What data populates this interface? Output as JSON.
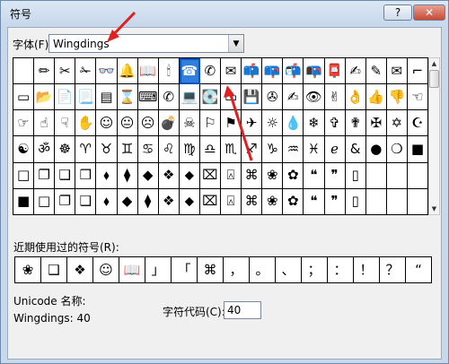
{
  "window": {
    "title": "符号",
    "help": "?",
    "close": "✕"
  },
  "font": {
    "label": "字体(F):",
    "value": "Wingdings"
  },
  "grid": [
    [
      "",
      "✏",
      "✂",
      "✁",
      "👓",
      "🔔",
      "📖",
      "🕯",
      "☎",
      "✆",
      "✉",
      "📫",
      "📪",
      "📬",
      "📭",
      "📮",
      "✍",
      "✎",
      "✉",
      "⌐"
    ],
    [
      "▭",
      "📂",
      "📄",
      "📃",
      "▤",
      "⌛",
      "⌨",
      "✆",
      "💻",
      "💽",
      "▭",
      "💾",
      "✇",
      "✍",
      "👁",
      "✌",
      "👌",
      "👍",
      "👎",
      "☜"
    ],
    [
      "☞",
      "☝",
      "☟",
      "✋",
      "☺",
      "😐",
      "☹",
      "💣",
      "☠",
      "⚐",
      "⚑",
      "✈",
      "☼",
      "💧",
      "❄",
      "✞",
      "✟",
      "✠",
      "✡",
      "☪"
    ],
    [
      "☯",
      "ॐ",
      "☸",
      "♈",
      "♉",
      "♊",
      "♋",
      "♌",
      "♍",
      "♎",
      "♏",
      "♐",
      "♑",
      "♒",
      "♓",
      "ℯ",
      "&",
      "●",
      "❍",
      "■"
    ],
    [
      "□",
      "❐",
      "❑",
      "❒",
      "⬧",
      "⧫",
      "◆",
      "❖",
      "⬥",
      "⌧",
      "⍓",
      "⌘",
      "❀",
      "✿",
      "❝",
      "❞",
      "▯",
      "",
      "",
      ""
    ],
    [
      "■",
      "□",
      "❐",
      "❑",
      "⬧",
      "◆",
      "⧫",
      "❖",
      "⬥",
      "⌧",
      "⍓",
      "⌘",
      "❀",
      "✿",
      "❝",
      "❞",
      "▯",
      "",
      "",
      ""
    ]
  ],
  "recent": {
    "label": "近期使用过的符号(R):",
    "items": [
      "❀",
      "❑",
      "❖",
      "☺",
      "📖",
      "」",
      "「",
      "⌘",
      "，",
      "。",
      "、",
      "；",
      "：",
      "！",
      "？",
      "“"
    ]
  },
  "unicode": {
    "label": "Unicode 名称:",
    "value": "Wingdings: 40"
  },
  "charcode": {
    "label": "字符代码(C):",
    "value": "40"
  }
}
